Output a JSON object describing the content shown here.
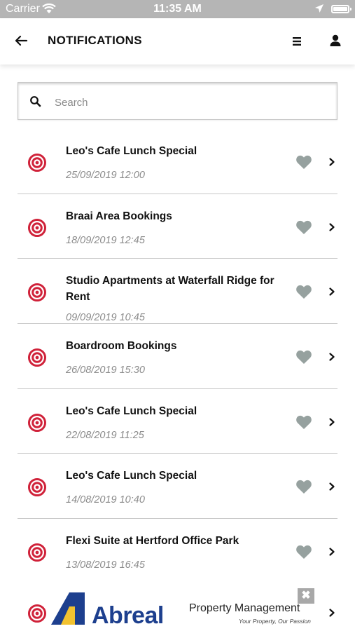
{
  "status_bar": {
    "carrier": "Carrier",
    "time": "11:35 AM"
  },
  "header": {
    "title": "NOTIFICATIONS"
  },
  "search": {
    "placeholder": "Search"
  },
  "notifications": [
    {
      "title": "Leo's Cafe Lunch Special",
      "date": "25/09/2019 12:00"
    },
    {
      "title": "Braai Area Bookings",
      "date": "18/09/2019 12:45"
    },
    {
      "title": "Studio Apartments at Waterfall Ridge for Rent",
      "date": "09/09/2019 10:45"
    },
    {
      "title": "Boardroom Bookings",
      "date": "26/08/2019 15:30"
    },
    {
      "title": "Leo's Cafe Lunch Special",
      "date": "22/08/2019 11:25"
    },
    {
      "title": "Leo's Cafe Lunch Special",
      "date": "14/08/2019 10:40"
    },
    {
      "title": "Flexi Suite at Hertford Office Park",
      "date": "13/08/2019 16:45"
    }
  ],
  "ad_banner": {
    "brand": "Abreal",
    "subtitle": "Property Management",
    "tagline": "Your Property, Our Passion",
    "close_label": "✖"
  },
  "colors": {
    "accent_red": "#d0223a",
    "heart_gray": "#96a19f",
    "brand_blue": "#1d3f8e",
    "brand_yellow": "#f2c230",
    "status_bar": "#b5b5b5"
  },
  "icons": [
    "back-arrow-icon",
    "menu-icon",
    "user-icon",
    "search-icon",
    "target-icon",
    "heart-icon",
    "chevron-right-icon",
    "close-icon"
  ]
}
